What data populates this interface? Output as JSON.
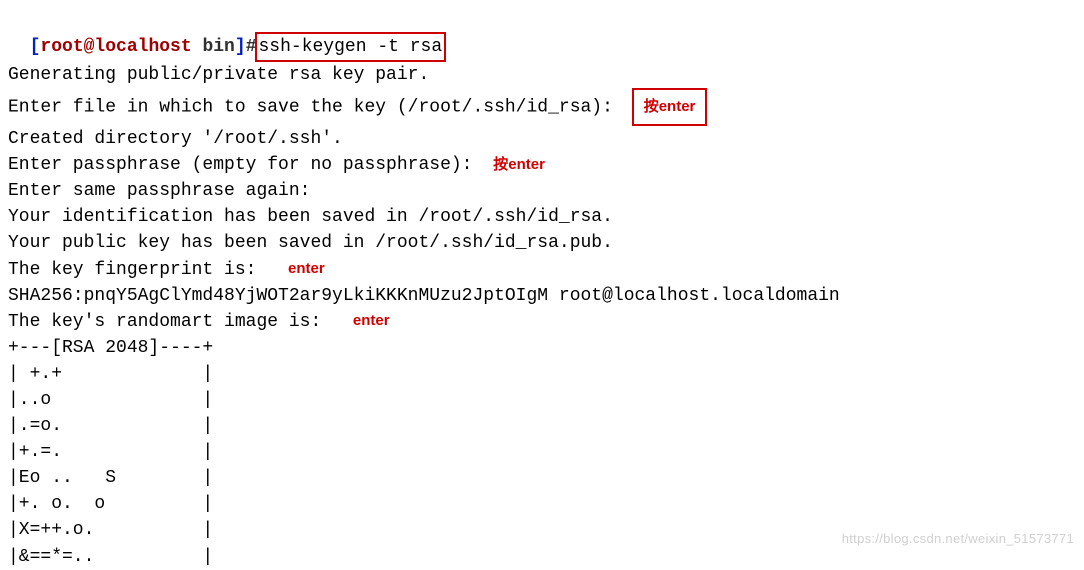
{
  "prompt": {
    "open_bracket": "[",
    "user": "root@localhost",
    "path": " bin",
    "close_bracket": "]",
    "hash": "#",
    "command": "ssh-keygen -t rsa"
  },
  "lines": {
    "l1": "Generating public/private rsa key pair.",
    "l2": "Enter file in which to save the key (/root/.ssh/id_rsa): ",
    "l3": "Created directory '/root/.ssh'.",
    "l4": "Enter passphrase (empty for no passphrase): ",
    "l5": "Enter same passphrase again:",
    "l6": "Your identification has been saved in /root/.ssh/id_rsa.",
    "l7": "Your public key has been saved in /root/.ssh/id_rsa.pub.",
    "l8": "The key fingerprint is:  ",
    "l9": "SHA256:pnqY5AgClYmd48YjWOT2ar9yLkiKKKnMUzu2JptOIgM root@localhost.localdomain",
    "l10": "The key's randomart image is:  ",
    "l11": "+---[RSA 2048]----+",
    "l12": "| +.+             |",
    "l13": "|..o              |",
    "l14": "|.=o.             |",
    "l15": "|+.=.             |",
    "l16": "|Eo ..   S        |",
    "l17": "|+. o.  o         |",
    "l18": "|X=++.o.          |",
    "l19": "|&==*=..          |"
  },
  "annotations": {
    "a1": "按enter",
    "a2": "按enter",
    "a3": "enter",
    "a4": "enter"
  },
  "watermark": "https://blog.csdn.net/weixin_51573771"
}
